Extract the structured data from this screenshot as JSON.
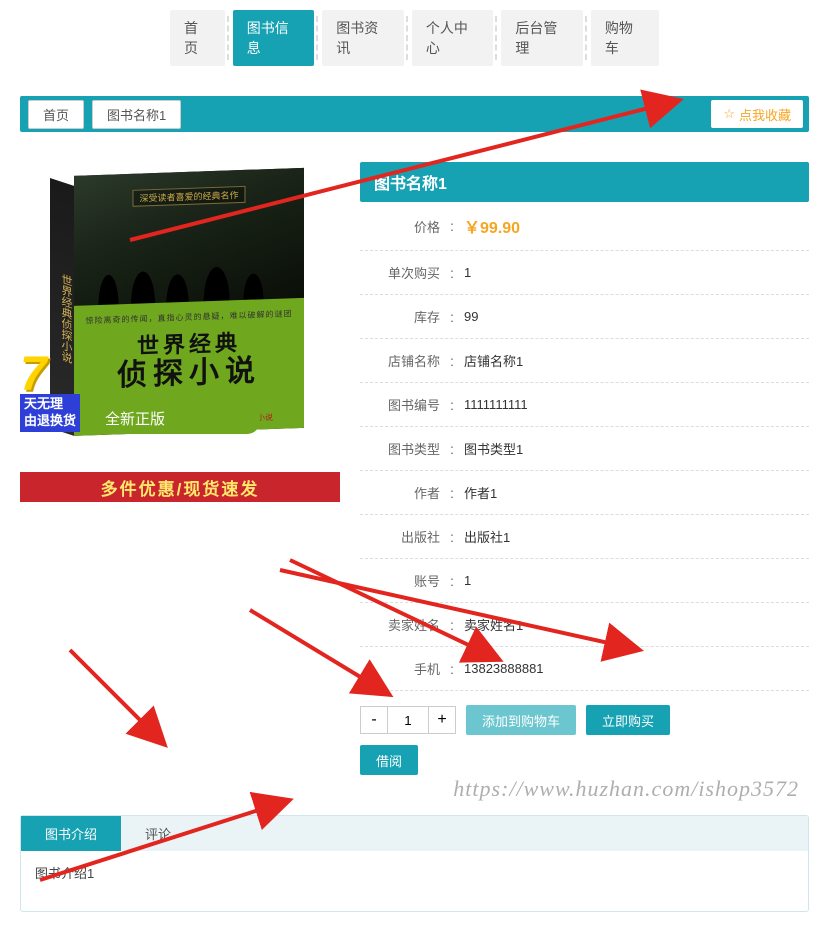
{
  "nav": {
    "items": [
      {
        "label": "首页",
        "active": false
      },
      {
        "label": "图书信息",
        "active": true
      },
      {
        "label": "图书资讯",
        "active": false
      },
      {
        "label": "个人中心",
        "active": false
      },
      {
        "label": "后台管理",
        "active": false
      },
      {
        "label": "购物车",
        "active": false
      }
    ]
  },
  "breadcrumb": {
    "home": "首页",
    "current": "图书名称1"
  },
  "favorite": {
    "icon": "☆",
    "label": "点我收藏"
  },
  "book": {
    "title": "图书名称1",
    "cover": {
      "spine": "世界经典侦探小说",
      "top_tag": "深受读者喜爱的经典名作",
      "subline": "惊险离奇的传闻，直指心灵的悬疑，难以破解的谜团",
      "line1": "世界经典",
      "line2": "侦探小说",
      "red_note": "古老之谜题，演化神探，惊险演绎系列精编小说",
      "badge_new": "全新正版",
      "promo_7_num": "7",
      "promo_7_line1": "天无理",
      "promo_7_line2": "由退换货",
      "promo_strip": "多件优惠/现货速发"
    },
    "rows": [
      {
        "label": "价格",
        "value": "￥99.90",
        "price": true
      },
      {
        "label": "单次购买",
        "value": "1"
      },
      {
        "label": "库存",
        "value": "99"
      },
      {
        "label": "店铺名称",
        "value": "店铺名称1"
      },
      {
        "label": "图书编号",
        "value": "1111111111"
      },
      {
        "label": "图书类型",
        "value": "图书类型1"
      },
      {
        "label": "作者",
        "value": "作者1"
      },
      {
        "label": "出版社",
        "value": "出版社1"
      },
      {
        "label": "账号",
        "value": "1"
      },
      {
        "label": "卖家姓名",
        "value": "卖家姓名1"
      },
      {
        "label": "手机",
        "value": "13823888881"
      }
    ],
    "qty": {
      "minus": "-",
      "value": "1",
      "plus": "+"
    },
    "btn_cart": "添加到购物车",
    "btn_buy": "立即购买",
    "btn_borrow": "借阅"
  },
  "tabs": {
    "items": [
      {
        "label": "图书介绍",
        "active": true
      },
      {
        "label": "评论",
        "active": false
      }
    ],
    "content": "图书介绍1"
  },
  "watermark": "https://www.huzhan.com/ishop3572"
}
